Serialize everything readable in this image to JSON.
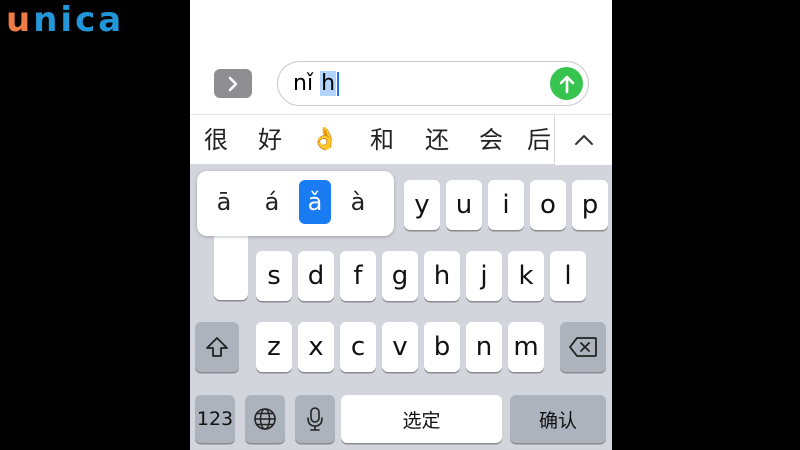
{
  "logo": {
    "first": "u",
    "rest": "nica"
  },
  "input": {
    "plain": "nǐ",
    "selected": "h"
  },
  "candidates": [
    "很",
    "好",
    "👌",
    "和",
    "还",
    "会",
    "后"
  ],
  "accent_popup": {
    "options": [
      "ā",
      "á",
      "ǎ",
      "à"
    ],
    "selected_index": 2
  },
  "keys": {
    "row1_visible": [
      "y",
      "u",
      "i",
      "o",
      "p"
    ],
    "row2": [
      "s",
      "d",
      "f",
      "g",
      "h",
      "j",
      "k",
      "l"
    ],
    "row3": [
      "z",
      "x",
      "c",
      "v",
      "b",
      "n",
      "m"
    ],
    "numbers": "123",
    "space": "选定",
    "confirm": "确认"
  },
  "colors": {
    "send": "#36c44f",
    "accent_highlight": "#1a7cf3",
    "logo_orange": "#f07c45",
    "logo_blue": "#2196d8"
  }
}
